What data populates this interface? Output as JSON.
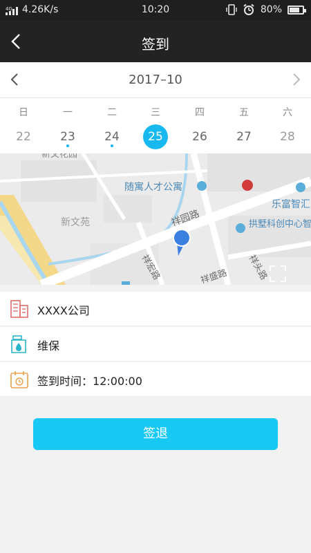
{
  "status_bar": {
    "network": "4G",
    "speed": "4.26K/s",
    "time": "10:20",
    "battery": "80%",
    "battery_level": 0.8
  },
  "header": {
    "title": "签到"
  },
  "calendar": {
    "month": "2017–10",
    "weekdays": [
      "日",
      "一",
      "二",
      "三",
      "四",
      "五",
      "六"
    ],
    "days": [
      "22",
      "23",
      "24",
      "25",
      "26",
      "27",
      "28"
    ],
    "selected": "25",
    "marked": [
      "23",
      "24"
    ]
  },
  "map": {
    "labels": [
      "新文花园",
      "随寓人才公寓",
      "乐富智汇",
      "新文苑",
      "祥园路",
      "拱墅科创中心智汇园",
      "祥宏路",
      "祥盛路",
      "祥头路"
    ]
  },
  "info": {
    "company": "XXXX公司",
    "type": "维保",
    "time_label": "签到时间：",
    "time_value": "12:00:00"
  },
  "actions": {
    "checkout_label": "签退"
  },
  "colors": {
    "accent": "#18b8f0",
    "button": "#18c8f5",
    "header": "#232323"
  },
  "icons": [
    "signal-icon",
    "back-icon",
    "chevron-left-icon",
    "chevron-right-icon",
    "building-icon",
    "drop-icon",
    "calendar-clock-icon",
    "location-pin-icon",
    "expand-icon",
    "alarm-icon"
  ]
}
